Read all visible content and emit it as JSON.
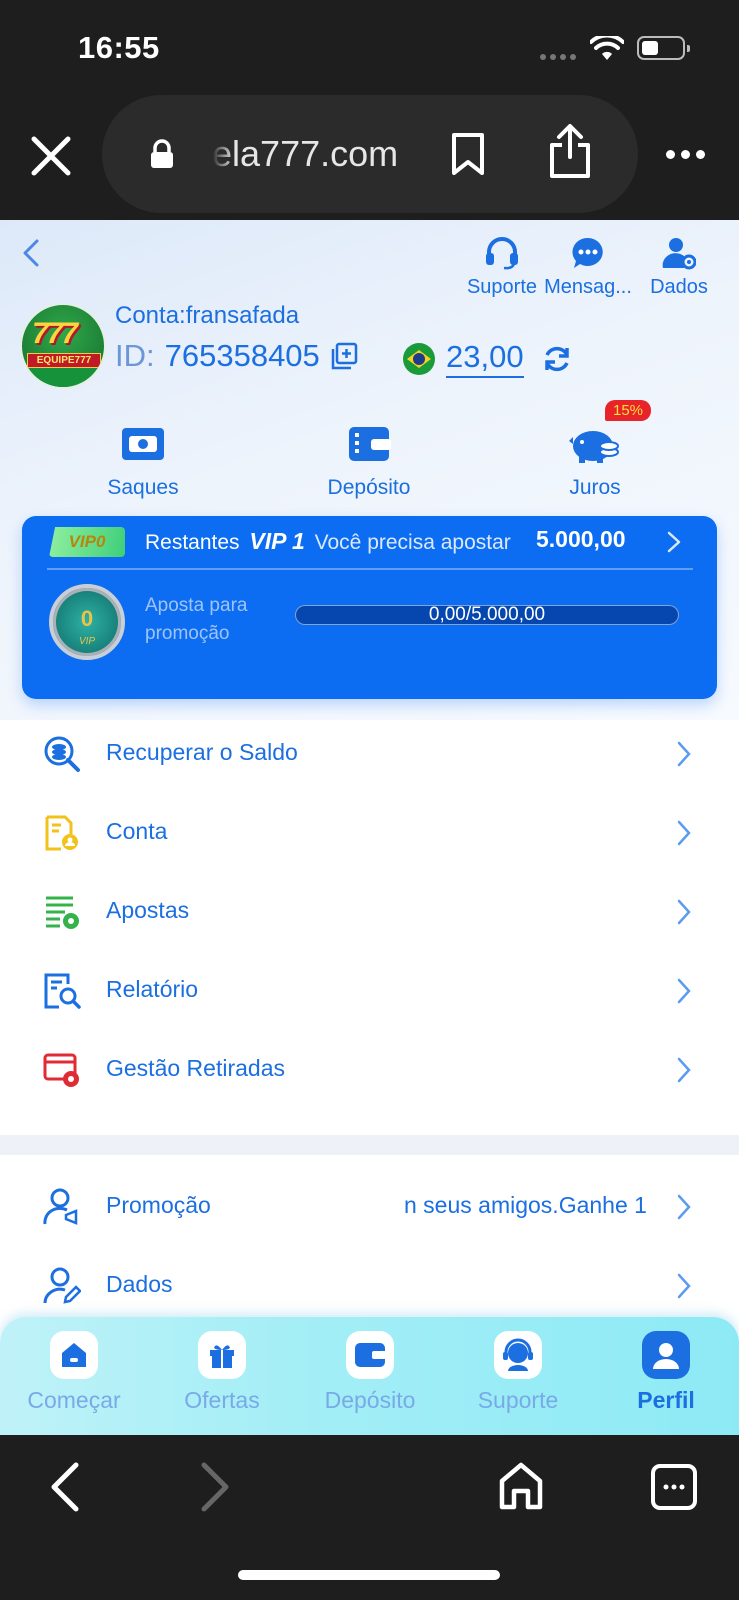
{
  "status_bar": {
    "time": "16:55"
  },
  "browser": {
    "url": "ela777.com"
  },
  "header": {
    "actions": [
      {
        "label": "Suporte",
        "icon": "headset-icon"
      },
      {
        "label": "Mensag...",
        "icon": "chat-icon"
      },
      {
        "label": "Dados",
        "icon": "user-settings-icon"
      }
    ],
    "account_label": "Conta:fransafada",
    "id_prefix": "ID:",
    "id_value": "765358405",
    "balance": "23,00",
    "avatar_text": "777",
    "avatar_band": "EQUIPE777"
  },
  "quick_actions": [
    {
      "label": "Saques",
      "icon": "withdraw-icon"
    },
    {
      "label": "Depósito",
      "icon": "wallet-icon"
    },
    {
      "label": "Juros",
      "icon": "piggy-bank-icon"
    }
  ],
  "juros_badge": "15%",
  "vip": {
    "tag": "VIP0",
    "remaining": "Restantes",
    "next_level": "VIP 1",
    "need_text": "Você precisa apostar",
    "amount": "5.000,00",
    "medal_level": "0",
    "medal_text": "VIP",
    "promo_label": "Aposta para promoção",
    "progress_text": "0,00/5.000,00",
    "progress_fraction": 0
  },
  "menu": [
    {
      "label": "Recuperar o Saldo",
      "icon": "coin-search-icon"
    },
    {
      "label": "Conta",
      "icon": "account-doc-icon"
    },
    {
      "label": "Apostas",
      "icon": "bets-list-icon"
    },
    {
      "label": "Relatório",
      "icon": "report-search-icon"
    },
    {
      "label": "Gestão Retiradas",
      "icon": "withdraw-settings-icon"
    }
  ],
  "menu2": [
    {
      "label": "Promoção",
      "extra": "n seus amigos.Ganhe 1",
      "icon": "user-promo-icon"
    },
    {
      "label": "Dados",
      "icon": "user-edit-icon"
    }
  ],
  "tabbar": [
    {
      "label": "Começar",
      "icon": "home-icon"
    },
    {
      "label": "Ofertas",
      "icon": "gift-icon"
    },
    {
      "label": "Depósito",
      "icon": "wallet-icon"
    },
    {
      "label": "Suporte",
      "icon": "support-agent-icon"
    },
    {
      "label": "Perfil",
      "icon": "profile-icon",
      "active": true
    }
  ],
  "colors": {
    "primary": "#1b6fe0",
    "vip_card": "#0c6cf2",
    "badge": "#e8242b"
  }
}
